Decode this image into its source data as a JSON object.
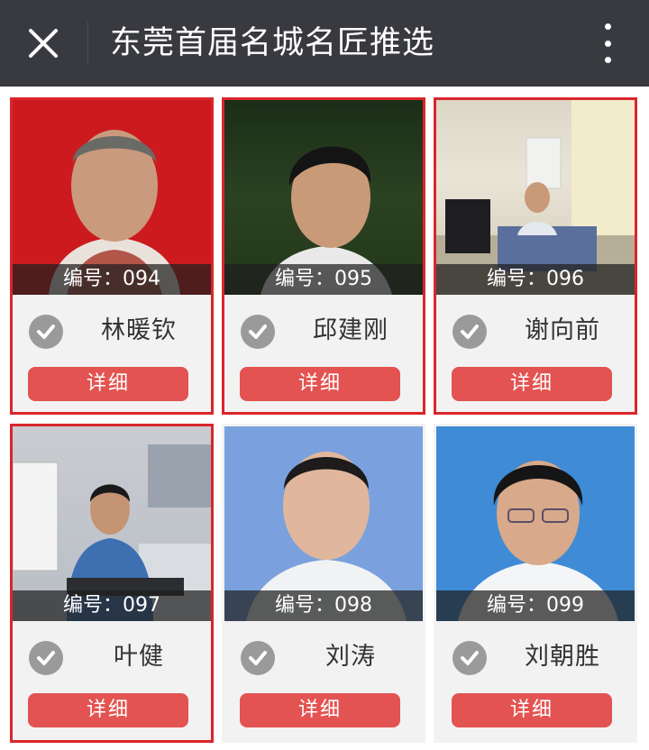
{
  "header": {
    "title": "东莞首届名城名匠推选",
    "close_icon": "close-icon",
    "more_icon": "more-vertical-icon",
    "background": "#393a3f"
  },
  "accent_color": "#e35351",
  "selected_border_color": "#d9262b",
  "candidates": [
    {
      "code_label": "编号：094",
      "name": "林暖钦",
      "detail_label": "详细",
      "selected": true
    },
    {
      "code_label": "编号：095",
      "name": "邱建刚",
      "detail_label": "详细",
      "selected": true
    },
    {
      "code_label": "编号：096",
      "name": "谢向前",
      "detail_label": "详细",
      "selected": true
    },
    {
      "code_label": "编号：097",
      "name": "叶健",
      "detail_label": "详细",
      "selected": true
    },
    {
      "code_label": "编号：098",
      "name": "刘涛",
      "detail_label": "详细",
      "selected": false
    },
    {
      "code_label": "编号：099",
      "name": "刘朝胜",
      "detail_label": "详细",
      "selected": false
    }
  ]
}
